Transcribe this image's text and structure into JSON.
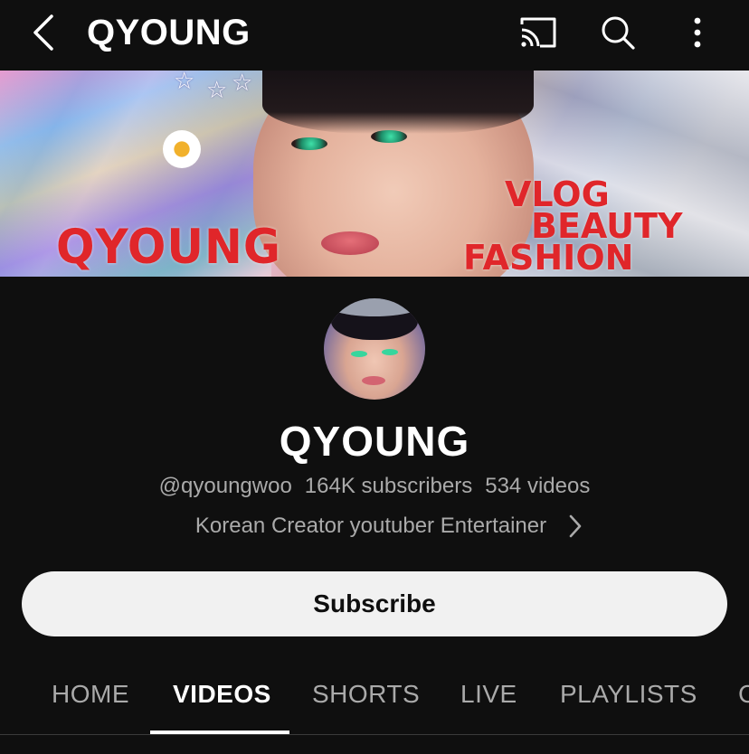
{
  "header": {
    "title": "QYOUNG",
    "icons": [
      "back-arrow-icon",
      "cast-icon",
      "search-icon",
      "more-vertical-icon"
    ]
  },
  "banner": {
    "channel_text": "QYOUNG",
    "tagline": [
      "VLOG",
      "BEAUTY",
      "FASHION"
    ]
  },
  "channel": {
    "name": "QYOUNG",
    "handle": "@qyoungwoo",
    "subscribers": "164K subscribers",
    "videos": "534 videos",
    "description": "Korean Creator youtuber Entertainer"
  },
  "subscribe": {
    "label": "Subscribe"
  },
  "tabs": [
    {
      "label": "HOME",
      "active": false
    },
    {
      "label": "VIDEOS",
      "active": true
    },
    {
      "label": "SHORTS",
      "active": false
    },
    {
      "label": "LIVE",
      "active": false
    },
    {
      "label": "PLAYLISTS",
      "active": false
    },
    {
      "label": "C",
      "active": false
    }
  ],
  "colors": {
    "background": "#0f0f0f",
    "text_primary": "#f1f1f1",
    "text_secondary": "#aaaaaa",
    "banner_text": "#e0262a",
    "button_bg": "#f1f1f1"
  }
}
